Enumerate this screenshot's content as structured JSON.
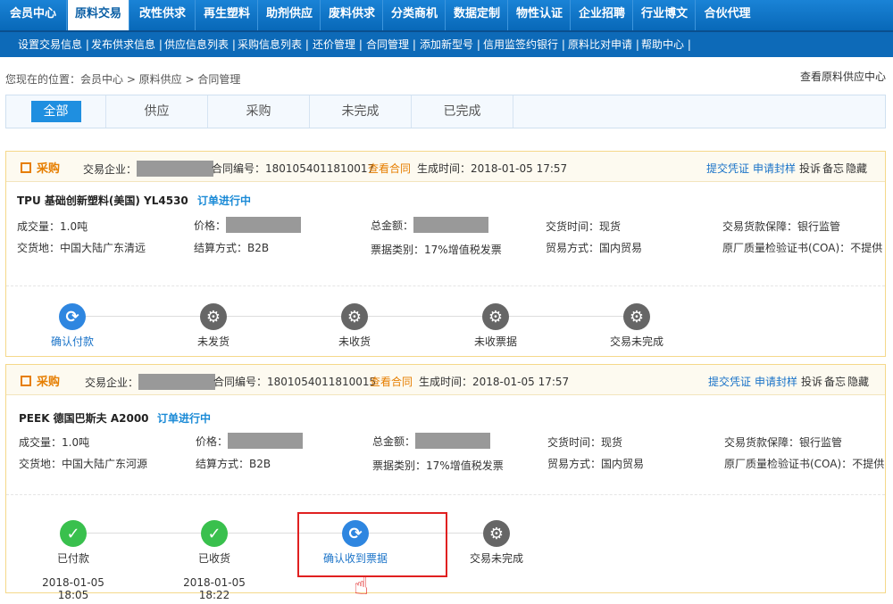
{
  "top_nav": [
    "会员中心",
    "原料交易",
    "改性供求",
    "再生塑料",
    "助剂供应",
    "废料供求",
    "分类商机",
    "数据定制",
    "物性认证",
    "企业招聘",
    "行业博文",
    "合伙代理"
  ],
  "sub_nav": [
    "设置交易信息 |",
    "发布供求信息 |",
    "供应信息列表 |",
    "采购信息列表 |",
    "还价管理 |",
    "合同管理 |",
    "添加新型号 |",
    "信用监签约银行 |",
    "原料比对申请 |",
    "帮助中心 |"
  ],
  "breadcrumb": "您现在的位置：会员中心 > 原料供应 > 合同管理",
  "top_right_link": "查看原料供应中心",
  "tabs": [
    "全部",
    "供应",
    "采购",
    "未完成",
    "已完成"
  ],
  "labels": {
    "tag": "采购",
    "enterprise": "交易企业：",
    "contract_no": "合同编号：",
    "view_contract": "查看合同",
    "gen_time": "生成时间：",
    "submit": "提交凭证",
    "sample": "申请封样",
    "complain": "投诉",
    "memo": "备忘",
    "hide": "隐藏",
    "qty": "成交量：",
    "price": "价格：",
    "total": "总金额：",
    "deal_time": "交货时间：",
    "guarantee": "交易货款保障：",
    "place": "交货地：",
    "settle": "结算方式：",
    "invoice": "票据类别：",
    "trade_mode": "贸易方式：",
    "coa": "原厂质量检验证书(COA)："
  },
  "cards": [
    {
      "contract_no": "1801054011810017",
      "gen_time": "2018-01-05 17:57",
      "product": "TPU 基础创新塑料(美国) YL4530",
      "status": "订单进行中",
      "qty": "1.0吨",
      "deal_time": "现货",
      "guarantee": "银行监管",
      "place": "中国大陆广东清远",
      "settle": "B2B",
      "invoice": "17%增值税发票",
      "trade_mode": "国内贸易",
      "coa": "不提供",
      "steps": [
        {
          "label": "确认付款",
          "state": "current",
          "time": ""
        },
        {
          "label": "未发货",
          "state": "pending",
          "time": ""
        },
        {
          "label": "未收货",
          "state": "pending",
          "time": ""
        },
        {
          "label": "未收票据",
          "state": "pending",
          "time": ""
        },
        {
          "label": "交易未完成",
          "state": "pending",
          "time": ""
        }
      ]
    },
    {
      "contract_no": "1801054011810015",
      "gen_time": "2018-01-05 17:57",
      "product": "PEEK 德国巴斯夫 A2000",
      "status": "订单进行中",
      "qty": "1.0吨",
      "deal_time": "现货",
      "guarantee": "银行监管",
      "place": "中国大陆广东河源",
      "settle": "B2B",
      "invoice": "17%增值税发票",
      "trade_mode": "国内贸易",
      "coa": "不提供",
      "steps": [
        {
          "label": "已付款",
          "state": "done",
          "time": "2018-01-05 18:05"
        },
        {
          "label": "已收货",
          "state": "done",
          "time": "2018-01-05 18:22"
        },
        {
          "label": "确认收到票据",
          "state": "current",
          "time": ""
        },
        {
          "label": "交易未完成",
          "state": "pending",
          "time": ""
        }
      ]
    }
  ],
  "icons": {
    "current": "refresh-icon",
    "pending": "gear-icon",
    "done": "check-icon"
  },
  "colors": {
    "nav_blue": "#0868b8",
    "accent_orange": "#e67e00",
    "link_blue": "#1a73c8",
    "highlight_red": "#e02020",
    "done_green": "#39c04d"
  }
}
